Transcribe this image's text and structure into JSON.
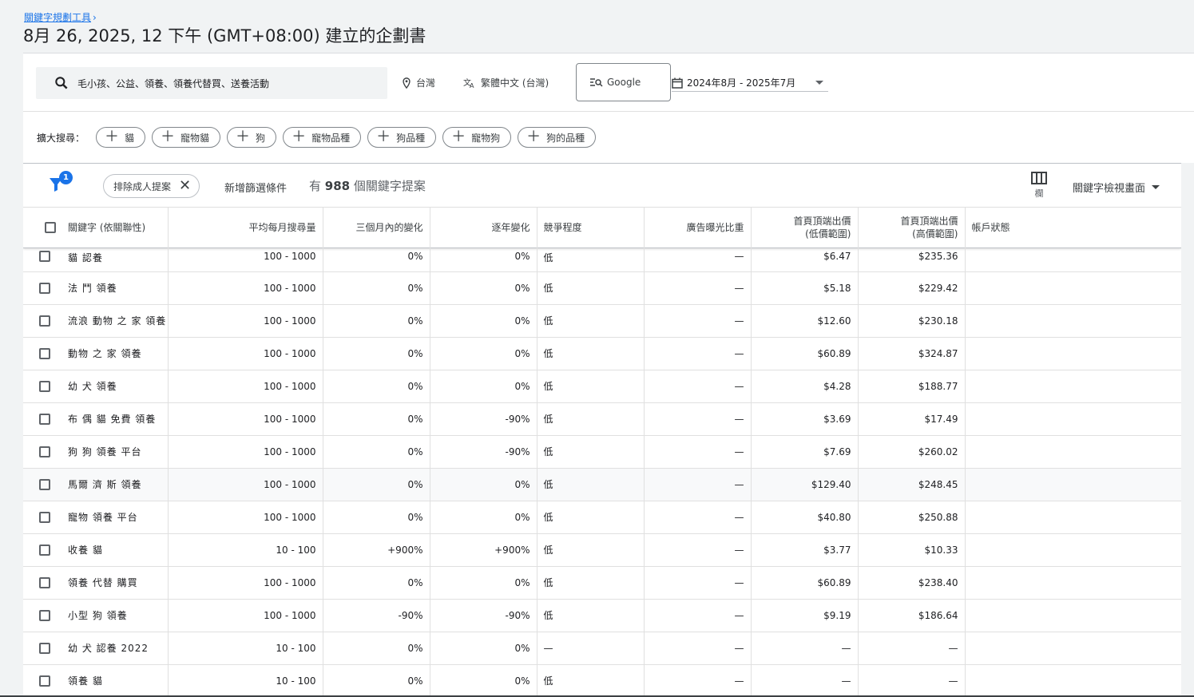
{
  "breadcrumb": {
    "label": "關鍵字規劃工具"
  },
  "page_title": "8月 26, 2025, 12 下午 (GMT+08:00) 建立的企劃書",
  "search": {
    "keywords": "毛小孩、公益、領養、領養代替買、送養活動",
    "location": "台灣",
    "language": "繁體中文 (台灣)",
    "engine": "Google",
    "date_range": "2024年8月 - 2025年7月"
  },
  "expand": {
    "label": "擴大搜尋：",
    "chips": [
      "貓",
      "寵物貓",
      "狗",
      "寵物品種",
      "狗品種",
      "寵物狗",
      "狗的品種"
    ]
  },
  "filter_bar": {
    "badge": "1",
    "chip_label": "排除成人提案",
    "add_filter": "新增篩選條件",
    "count_prefix": "有",
    "count_value": "988",
    "count_suffix": "個關鍵字提案",
    "columns_label": "欄",
    "view_label": "關鍵字檢視畫面"
  },
  "table": {
    "headers": {
      "keyword": "關鍵字 (依關聯性)",
      "avg_monthly": "平均每月搜尋量",
      "three_month": "三個月內的變化",
      "yoy": "逐年變化",
      "competition": "競爭程度",
      "impression_share": "廣告曝光比重",
      "bid_low": "首頁頂端出價\n(低價範圍)",
      "bid_high": "首頁頂端出價\n(高價範圍)",
      "account_status": "帳戶狀態"
    },
    "rows": [
      {
        "keyword": "貓 認養",
        "avg": "100 - 1000",
        "three": "0%",
        "yoy": "0%",
        "comp": "低",
        "share": "—",
        "low": "$6.47",
        "high": "$235.36"
      },
      {
        "keyword": "法 鬥 領養",
        "avg": "100 - 1000",
        "three": "0%",
        "yoy": "0%",
        "comp": "低",
        "share": "—",
        "low": "$5.18",
        "high": "$229.42"
      },
      {
        "keyword": "流浪 動物 之 家 領養",
        "avg": "100 - 1000",
        "three": "0%",
        "yoy": "0%",
        "comp": "低",
        "share": "—",
        "low": "$12.60",
        "high": "$230.18"
      },
      {
        "keyword": "動物 之 家 領養",
        "avg": "100 - 1000",
        "three": "0%",
        "yoy": "0%",
        "comp": "低",
        "share": "—",
        "low": "$60.89",
        "high": "$324.87"
      },
      {
        "keyword": "幼 犬 領養",
        "avg": "100 - 1000",
        "three": "0%",
        "yoy": "0%",
        "comp": "低",
        "share": "—",
        "low": "$4.28",
        "high": "$188.77"
      },
      {
        "keyword": "布 偶 貓 免費 領養",
        "avg": "100 - 1000",
        "three": "0%",
        "yoy": "-90%",
        "comp": "低",
        "share": "—",
        "low": "$3.69",
        "high": "$17.49"
      },
      {
        "keyword": "狗 狗 領養 平台",
        "avg": "100 - 1000",
        "three": "0%",
        "yoy": "-90%",
        "comp": "低",
        "share": "—",
        "low": "$7.69",
        "high": "$260.02"
      },
      {
        "keyword": "馬爾 濟 斯 領養",
        "avg": "100 - 1000",
        "three": "0%",
        "yoy": "0%",
        "comp": "低",
        "share": "—",
        "low": "$129.40",
        "high": "$248.45"
      },
      {
        "keyword": "寵物 領養 平台",
        "avg": "100 - 1000",
        "three": "0%",
        "yoy": "0%",
        "comp": "低",
        "share": "—",
        "low": "$40.80",
        "high": "$250.88"
      },
      {
        "keyword": "收養 貓",
        "avg": "10 - 100",
        "three": "+900%",
        "yoy": "+900%",
        "comp": "低",
        "share": "—",
        "low": "$3.77",
        "high": "$10.33"
      },
      {
        "keyword": "領養 代替 購買",
        "avg": "100 - 1000",
        "three": "0%",
        "yoy": "0%",
        "comp": "低",
        "share": "—",
        "low": "$60.89",
        "high": "$238.40"
      },
      {
        "keyword": "小型 狗 領養",
        "avg": "100 - 1000",
        "three": "-90%",
        "yoy": "-90%",
        "comp": "低",
        "share": "—",
        "low": "$9.19",
        "high": "$186.64"
      },
      {
        "keyword": "幼 犬 認養 2022",
        "avg": "10 - 100",
        "three": "0%",
        "yoy": "0%",
        "comp": "—",
        "share": "—",
        "low": "—",
        "high": "—"
      },
      {
        "keyword": "領養 貓",
        "avg": "10 - 100",
        "three": "0%",
        "yoy": "0%",
        "comp": "低",
        "share": "—",
        "low": "—",
        "high": "—"
      }
    ]
  },
  "colors": {
    "accent": "#1a73e8",
    "background": "#f1f3f4"
  }
}
